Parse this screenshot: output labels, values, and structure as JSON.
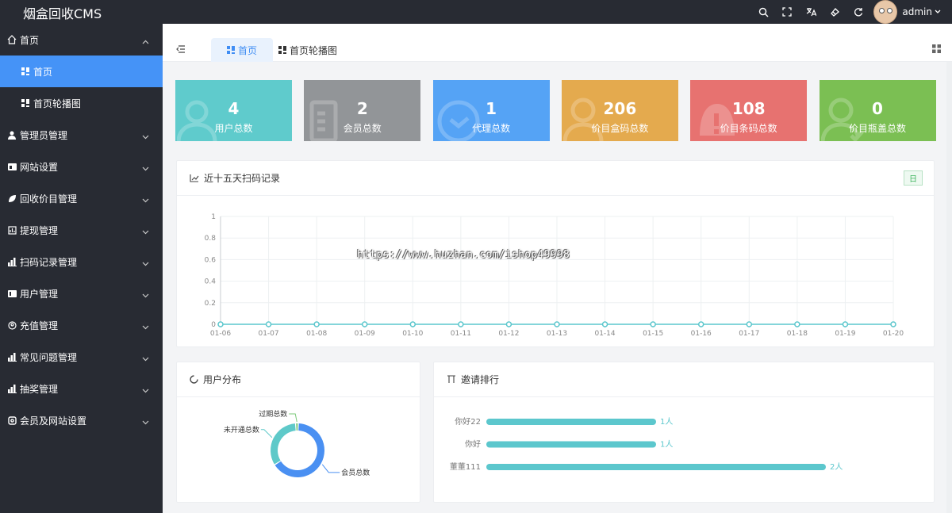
{
  "app": {
    "title": "烟盒回收CMS",
    "user": "admin"
  },
  "topbar_icons": [
    "search-icon",
    "fullscreen-icon",
    "translate-icon",
    "theme-icon",
    "refresh-icon"
  ],
  "sidebar": {
    "items": [
      {
        "label": "首页",
        "icon": "home-icon",
        "expanded": true
      },
      {
        "label": "首页",
        "icon": "dashboard-icon",
        "sub": true,
        "active": true
      },
      {
        "label": "首页轮播图",
        "icon": "dashboard-icon",
        "sub": true
      },
      {
        "label": "管理员管理",
        "icon": "admin-icon"
      },
      {
        "label": "网站设置",
        "icon": "site-icon"
      },
      {
        "label": "回收价目管理",
        "icon": "leaf-icon"
      },
      {
        "label": "提现管理",
        "icon": "withdraw-icon"
      },
      {
        "label": "扫码记录管理",
        "icon": "bar-icon"
      },
      {
        "label": "用户管理",
        "icon": "user-icon"
      },
      {
        "label": "充值管理",
        "icon": "recharge-icon"
      },
      {
        "label": "常见问题管理",
        "icon": "bar-icon"
      },
      {
        "label": "抽奖管理",
        "icon": "bar-icon"
      },
      {
        "label": "会员及网站设置",
        "icon": "settings-icon"
      }
    ]
  },
  "tabs": [
    {
      "label": "首页",
      "active": true
    },
    {
      "label": "首页轮播图",
      "active": false
    }
  ],
  "stats": [
    {
      "value": "4",
      "label": "用户总数",
      "color": "#5fcbcc",
      "icon": "users-bg-icon"
    },
    {
      "value": "2",
      "label": "会员总数",
      "color": "#929598",
      "icon": "doc-bg-icon"
    },
    {
      "value": "1",
      "label": "代理总数",
      "color": "#55a3f5",
      "icon": "clock-bg-icon"
    },
    {
      "value": "206",
      "label": "价目盒码总数",
      "color": "#e4aa4e",
      "icon": "user-bg-icon"
    },
    {
      "value": "108",
      "label": "价目条码总数",
      "color": "#e77270",
      "icon": "bell-bg-icon"
    },
    {
      "value": "0",
      "label": "价目瓶盖总数",
      "color": "#7bbf53",
      "icon": "user-check-bg-icon"
    }
  ],
  "scan_panel": {
    "title": "近十五天扫码记录",
    "range_button": "日"
  },
  "watermark": "https://www.huzhan.com/ishop49998",
  "chart_data": [
    {
      "type": "line",
      "title": "近十五天扫码记录",
      "x": [
        "01-06",
        "01-07",
        "01-08",
        "01-09",
        "01-10",
        "01-11",
        "01-12",
        "01-13",
        "01-14",
        "01-15",
        "01-16",
        "01-17",
        "01-18",
        "01-19",
        "01-20"
      ],
      "series": [
        {
          "values": [
            0,
            0,
            0,
            0,
            0,
            0,
            0,
            0,
            0,
            0,
            0,
            0,
            0,
            0,
            0
          ]
        }
      ],
      "ylim": [
        0,
        1
      ],
      "yticks": [
        "0",
        "0.2",
        "0.4",
        "0.6",
        "0.8",
        "1"
      ],
      "grid": true,
      "color": "#5cc7cd"
    },
    {
      "type": "pie",
      "title": "用户分布",
      "slices": [
        {
          "label": "会员总数",
          "value": 2,
          "color": "#4a90f2"
        },
        {
          "label": "未开通总数",
          "value": 1,
          "color": "#5ec9c9"
        },
        {
          "label": "过期总数",
          "value": 0.05,
          "color": "#7bc97a"
        }
      ]
    },
    {
      "type": "bar",
      "title": "邀请排行",
      "categories": [
        "你好22",
        "你好",
        "董董111"
      ],
      "values": [
        1,
        1,
        2
      ],
      "value_labels": [
        "1人",
        "1人",
        "2人"
      ],
      "color": "#5cc7cd"
    }
  ],
  "user_panel": {
    "title": "用户分布"
  },
  "invite_panel": {
    "title": "邀请排行"
  }
}
